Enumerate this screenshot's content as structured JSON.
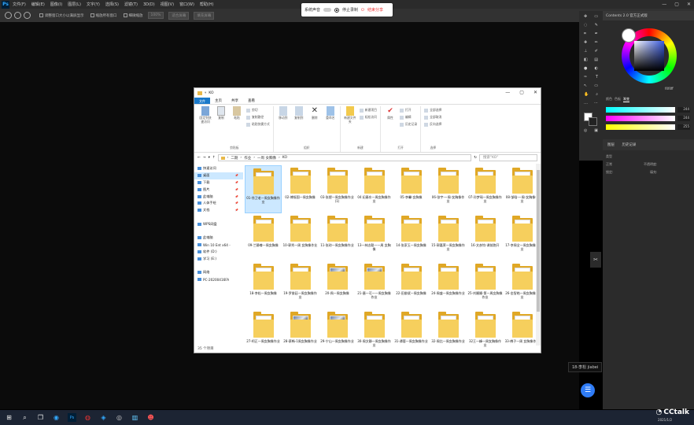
{
  "ps": {
    "menu": [
      "文件(F)",
      "编辑(E)",
      "图像(I)",
      "图层(L)",
      "文字(Y)",
      "选择(S)",
      "滤镜(T)",
      "3D(D)",
      "视图(V)",
      "窗口(W)",
      "帮助(H)"
    ],
    "options": {
      "resize_all": "调整窗口大小以满屏显示",
      "zoom_all": "缩放所有窗口",
      "scrubby": "细微缩放",
      "fit_screen": "适合屏幕",
      "fill_screen": "填充屏幕",
      "pct": "100%"
    },
    "color_panel_title": "Contents 2.0 官方正式版",
    "slider_tabs": [
      "颜色",
      "色板",
      "渐变"
    ],
    "slider_values": [
      "244",
      "244",
      "255"
    ],
    "hex": "f4f4ff",
    "layers_tabs": [
      "图层",
      "历史记录"
    ],
    "layers_search": "类型",
    "layers_mode": "正常",
    "layers_opacity": "不透明度:",
    "layers_lock": "锁定:",
    "layers_fill": "填充:"
  },
  "share_bar": {
    "system_sound": "系统声音",
    "stop_record": "停止录制",
    "end_share": "结束分享"
  },
  "explorer": {
    "title": "KO",
    "tabs": [
      "文件",
      "主页",
      "共享",
      "查看"
    ],
    "ribbon": {
      "clipboard": {
        "label": "剪贴板",
        "pin": "固定到快速访问",
        "copy": "复制",
        "paste": "粘贴",
        "cut": "剪切",
        "copy_path": "复制路径",
        "paste_shortcut": "粘贴快捷方式"
      },
      "organize": {
        "label": "组织",
        "move_to": "移动到",
        "copy_to": "复制到",
        "delete": "删除",
        "rename": "重命名"
      },
      "new": {
        "label": "新建",
        "new_folder": "新建文件夹",
        "new_item": "新建项目",
        "easy_access": "轻松访问"
      },
      "open": {
        "label": "打开",
        "properties": "属性",
        "open": "打开",
        "edit": "编辑",
        "history": "历史记录"
      },
      "select": {
        "label": "选择",
        "select_all": "全部选择",
        "select_none": "全部取消",
        "invert": "反向选择"
      }
    },
    "path": [
      "二期",
      "作业",
      "一周 女胸像",
      "KO"
    ],
    "search_placeholder": "搜索\"KO\"",
    "nav": [
      {
        "label": "快速访问",
        "pin": false
      },
      {
        "label": "桌面",
        "pin": true
      },
      {
        "label": "下载",
        "pin": true
      },
      {
        "label": "图片",
        "pin": true
      },
      {
        "label": "此电脑",
        "pin": true
      },
      {
        "label": "人体手绘",
        "pin": true
      },
      {
        "label": "文档",
        "pin": true
      },
      {
        "label": "",
        "pin": false
      },
      {
        "label": "WPS网盘",
        "pin": false
      },
      {
        "label": "",
        "pin": false
      },
      {
        "label": "此电脑",
        "pin": false
      },
      {
        "label": "Win 10 Ent x64 -",
        "pin": false
      },
      {
        "label": "软件 (D:)",
        "pin": false
      },
      {
        "label": "学习 (E:)",
        "pin": false
      },
      {
        "label": "",
        "pin": false
      },
      {
        "label": "网络",
        "pin": false
      },
      {
        "label": "PC-20200416FA",
        "pin": false
      }
    ],
    "files": [
      {
        "name": "01-徐卫老一周女胸像作业",
        "photo": false,
        "sel": true
      },
      {
        "name": "02-傅振国一周女胸像",
        "photo": false,
        "sel": false
      },
      {
        "name": "03-张煜一周女胸像作业(1)",
        "photo": false,
        "sel": false
      },
      {
        "name": "04 纪春东—周女胸像作业",
        "photo": false,
        "sel": false
      },
      {
        "name": "05-李馨-女胸像",
        "photo": false,
        "sel": false
      },
      {
        "name": "06-张宇-一周-女胸像作业",
        "photo": false,
        "sel": false
      },
      {
        "name": "07-孙梦瑶—周女胸像作业",
        "photo": false,
        "sel": false
      },
      {
        "name": "08-邹晗-一周-女胸像作业",
        "photo": false,
        "sel": false
      },
      {
        "name": "09-兰静尊—周女胸像",
        "photo": false,
        "sel": false
      },
      {
        "name": "10-郭秀—周 女胸像作业",
        "photo": false,
        "sel": false
      },
      {
        "name": "11-张琼—周女胸像作业",
        "photo": false,
        "sel": false
      },
      {
        "name": "13—林志聪——周 女胸像",
        "photo": false,
        "sel": false
      },
      {
        "name": "14-张家玉—周女胸像",
        "photo": false,
        "sel": false
      },
      {
        "name": "15-郭嘉莱—周女胸像作业",
        "photo": false,
        "sel": false
      },
      {
        "name": "16-文彦钧-课前跑开",
        "photo": false,
        "sel": false
      },
      {
        "name": "17-李周全—周女胸像作业",
        "photo": false,
        "sel": false
      },
      {
        "name": "18-李松—周女胸像",
        "photo": false,
        "sel": false
      },
      {
        "name": "19-罗俊廷—周女胸像作业",
        "photo": false,
        "sel": false
      },
      {
        "name": "20-佩—周女胸像",
        "photo": true,
        "sel": false
      },
      {
        "name": "21-唐—可——周女胸像作业",
        "photo": true,
        "sel": false
      },
      {
        "name": "22-田俊斌—周女胸像",
        "photo": false,
        "sel": false
      },
      {
        "name": "24-周盛—周女胸像作业",
        "photo": false,
        "sel": false
      },
      {
        "name": "25-刘姗姗-第一周女胸像作业",
        "photo": false,
        "sel": false
      },
      {
        "name": "26-金智皓—周女胸像作业",
        "photo": false,
        "sel": false
      },
      {
        "name": "27-柯正—周女胸像作业",
        "photo": false,
        "sel": false
      },
      {
        "name": "28-蔡畅-1周女胸像作业",
        "photo": true,
        "sel": false
      },
      {
        "name": "29-宁山—周女胸像作业",
        "photo": true,
        "sel": false
      },
      {
        "name": "30-周文静—周女胸像作业",
        "photo": false,
        "sel": false
      },
      {
        "name": "31-谭蓉—周女胸像作业",
        "photo": false,
        "sel": false
      },
      {
        "name": "32-周比—周女胸像作业",
        "photo": false,
        "sel": false
      },
      {
        "name": "32王一峰—周女胸像作业",
        "photo": false,
        "sel": false
      },
      {
        "name": "33-傅子—周 女胸像作业",
        "photo": false,
        "sel": false
      }
    ],
    "status": "35 个项目"
  },
  "tooltip": "18-李松 jiabei",
  "cctalk": "CCtalk",
  "clock": "2021/1/2"
}
